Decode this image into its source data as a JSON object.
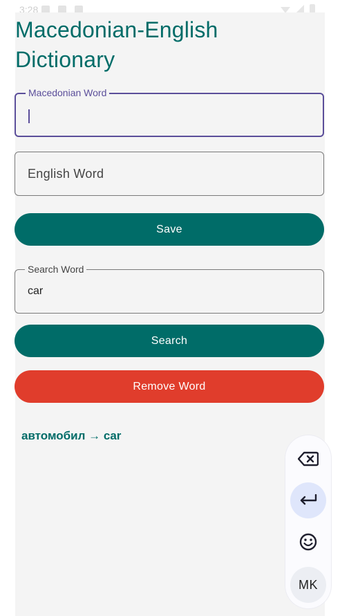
{
  "app": {
    "title": "Macedonian-English Dictionary"
  },
  "status_bar": {
    "time": "3:28"
  },
  "form": {
    "macedonian_field": {
      "label": "Macedonian Word",
      "value": ""
    },
    "english_field": {
      "placeholder": "English Word"
    },
    "save_label": "Save",
    "search_field": {
      "label": "Search Word",
      "value": "car"
    },
    "search_label": "Search",
    "remove_label": "Remove Word"
  },
  "result": {
    "text": "автомобил → car"
  },
  "keyboard": {
    "keys": [
      "backspace-icon",
      "enter-icon",
      "emoji-icon",
      "language-switch"
    ],
    "language_label": "MK"
  },
  "colors": {
    "primary": "#006c68",
    "focused_outline": "#5b4e9a",
    "danger": "#e03d2c",
    "background": "#f4f4f4"
  }
}
